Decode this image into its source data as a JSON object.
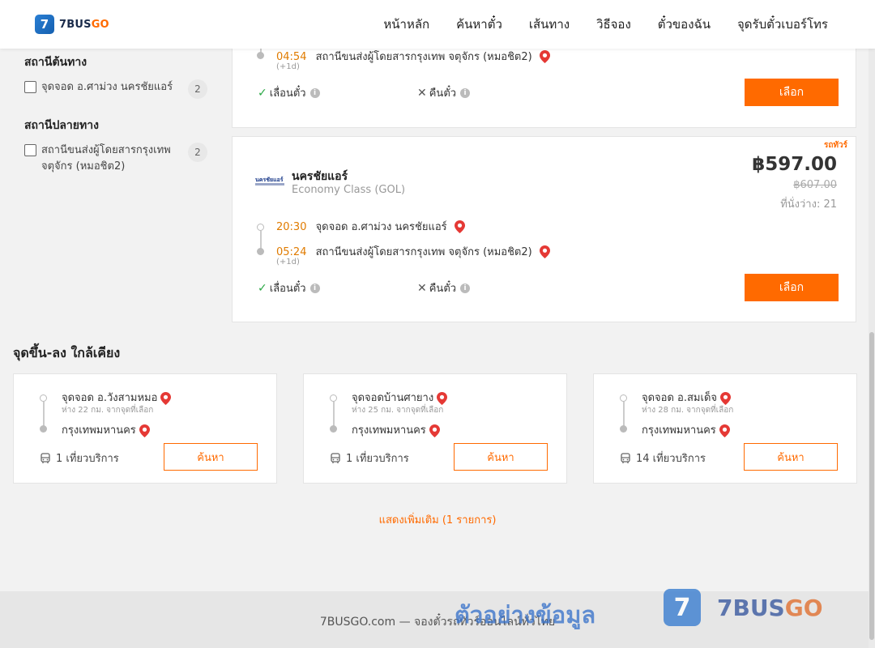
{
  "header": {
    "logo_text": "7BUS",
    "logo_text_go": "GO",
    "logo_badge": "7",
    "nav": [
      "หน้าหลัก",
      "ค้นหาตั๋ว",
      "เส้นทาง",
      "วิธีจอง",
      "ตั๋วของฉัน",
      "จุดรับตั๋วเบอร์โทร"
    ]
  },
  "sidebar": {
    "origin_title": "สถานีต้นทาง",
    "origin_items": [
      {
        "label": "จุดจอด อ.ศาม่วง นครชัยแอร์",
        "count": "2"
      }
    ],
    "dest_title": "สถานีปลายทาง",
    "dest_items": [
      {
        "label": "สถานีขนส่งผู้โดยสารกรุงเทพ จตุจักร (หมอชิต2)",
        "count": "2"
      }
    ]
  },
  "card_top": {
    "arrive_time": "04:54",
    "arrive_plus": "(+1d)",
    "arrive_stop": "สถานีขนส่งผู้โดยสารกรุงเทพ จตุจักร (หมอชิต2)",
    "reschedule": "เลื่อนตั๋ว",
    "refund": "คืนตั๋ว",
    "select": "เลือก"
  },
  "card_2": {
    "promo_tag": "รถทัวร์",
    "operator": "นครชัยแอร์",
    "class": "Economy Class (GOL)",
    "price": "฿597.00",
    "price_old": "฿607.00",
    "seats": "ที่นั่งว่าง: 21",
    "depart_time": "20:30",
    "depart_stop": "จุดจอด อ.ศาม่วง นครชัยแอร์",
    "arrive_time": "05:24",
    "arrive_plus": "(+1d)",
    "arrive_stop": "สถานีขนส่งผู้โดยสารกรุงเทพ จตุจักร (หมอชิต2)",
    "reschedule": "เลื่อนตั๋ว",
    "refund": "คืนตั๋ว",
    "select": "เลือก"
  },
  "nearby": {
    "title": "จุดขึ้น-ลง ใกล้เคียง",
    "items": [
      {
        "from": "จุดจอด อ.วังสามหมอ",
        "distance": "ห่าง 22 กม. จากจุดที่เลือก",
        "to": "กรุงเทพมหานคร",
        "trips": "1 เที่ยวบริการ",
        "button": "ค้นหา"
      },
      {
        "from": "จุดจอดบ้านศายาง",
        "distance": "ห่าง 25 กม. จากจุดที่เลือก",
        "to": "กรุงเทพมหานคร",
        "trips": "1 เที่ยวบริการ",
        "button": "ค้นหา"
      },
      {
        "from": "จุดจอด อ.สมเด็จ",
        "distance": "ห่าง 28 กม. จากจุดที่เลือก",
        "to": "กรุงเทพมหานคร",
        "trips": "14 เที่ยวบริการ",
        "button": "ค้นหา"
      }
    ],
    "show_more": "แสดงเพิ่มเติม (1 รายการ)"
  },
  "footer": {
    "text": "7BUSGO.com — จองตั๋วรถทัวร์ออนไลน์ทั่วไทย",
    "watermark_text": "ตัวอย่างข้อมูล",
    "watermark_badge": "7",
    "watermark_word": "7BUS",
    "watermark_word_go": "GO"
  },
  "colors": {
    "accent": "#ff6a00",
    "time": "#e07b00",
    "check": "#2aa845",
    "pin": "#e53935"
  }
}
